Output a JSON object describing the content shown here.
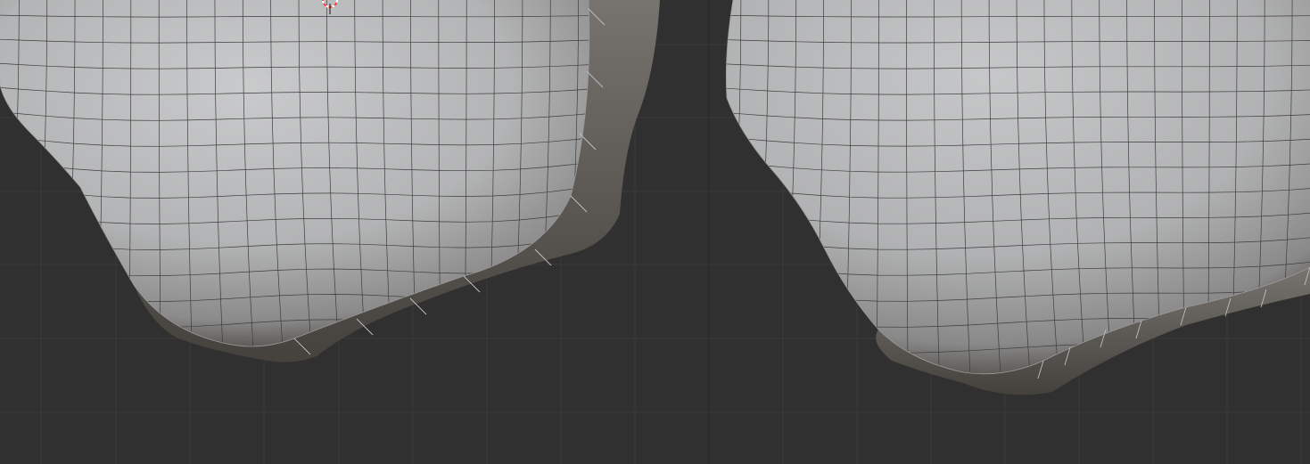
{
  "viewport": {
    "background_color": "#303030",
    "grid_color": "#3a3a3a",
    "grid_major_color": "#262626",
    "mesh_fill_light": "#c8c9ca",
    "mesh_fill_mid": "#a8a9aa",
    "mesh_fill_dark": "#6f6c69",
    "mesh_rim_color": "#4e4a46",
    "wire_color": "#3d3d3d",
    "wire_edge_color": "#bdbdbd",
    "cursor_color": "#ff3b3b"
  },
  "objects": [
    {
      "name": "left-mesh-object",
      "shading": "solid-with-wireframe"
    },
    {
      "name": "right-mesh-object",
      "shading": "solid-with-wireframe"
    }
  ],
  "cursor_icon": "3d-cursor-icon"
}
